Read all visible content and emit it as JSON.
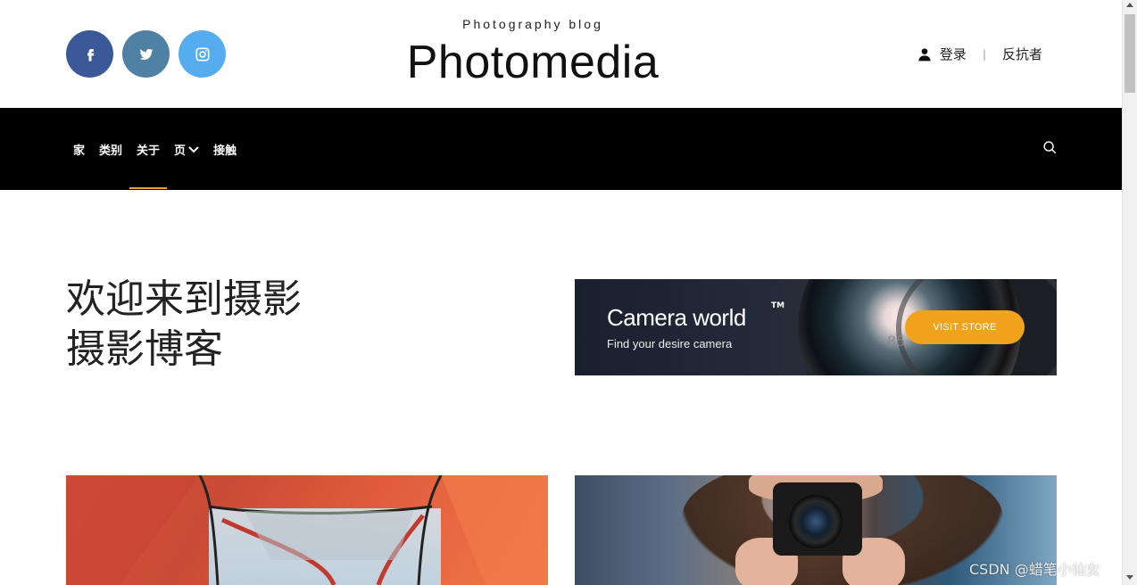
{
  "header": {
    "tagline": "Photography blog",
    "logo": "Photomedia",
    "login_label": "登录",
    "separator": "|",
    "register_label": "反抗者",
    "social": [
      "facebook-icon",
      "twitter-icon",
      "instagram-icon"
    ]
  },
  "nav": {
    "items": [
      {
        "label": "家"
      },
      {
        "label": "类别"
      },
      {
        "label": "关于"
      },
      {
        "label": "页"
      },
      {
        "label": "接触"
      }
    ],
    "active_index": 2,
    "accent_color": "#f2a31c"
  },
  "hero": {
    "line1": "欢迎来到摄影",
    "line2": "摄影博客"
  },
  "banner": {
    "title": "Camera world",
    "trademark": "TM",
    "subtitle": "Find your desire camera",
    "button": "VISIT STORE",
    "lens_number": "85"
  },
  "watermark": "CSDN @蜡笔小仙女"
}
